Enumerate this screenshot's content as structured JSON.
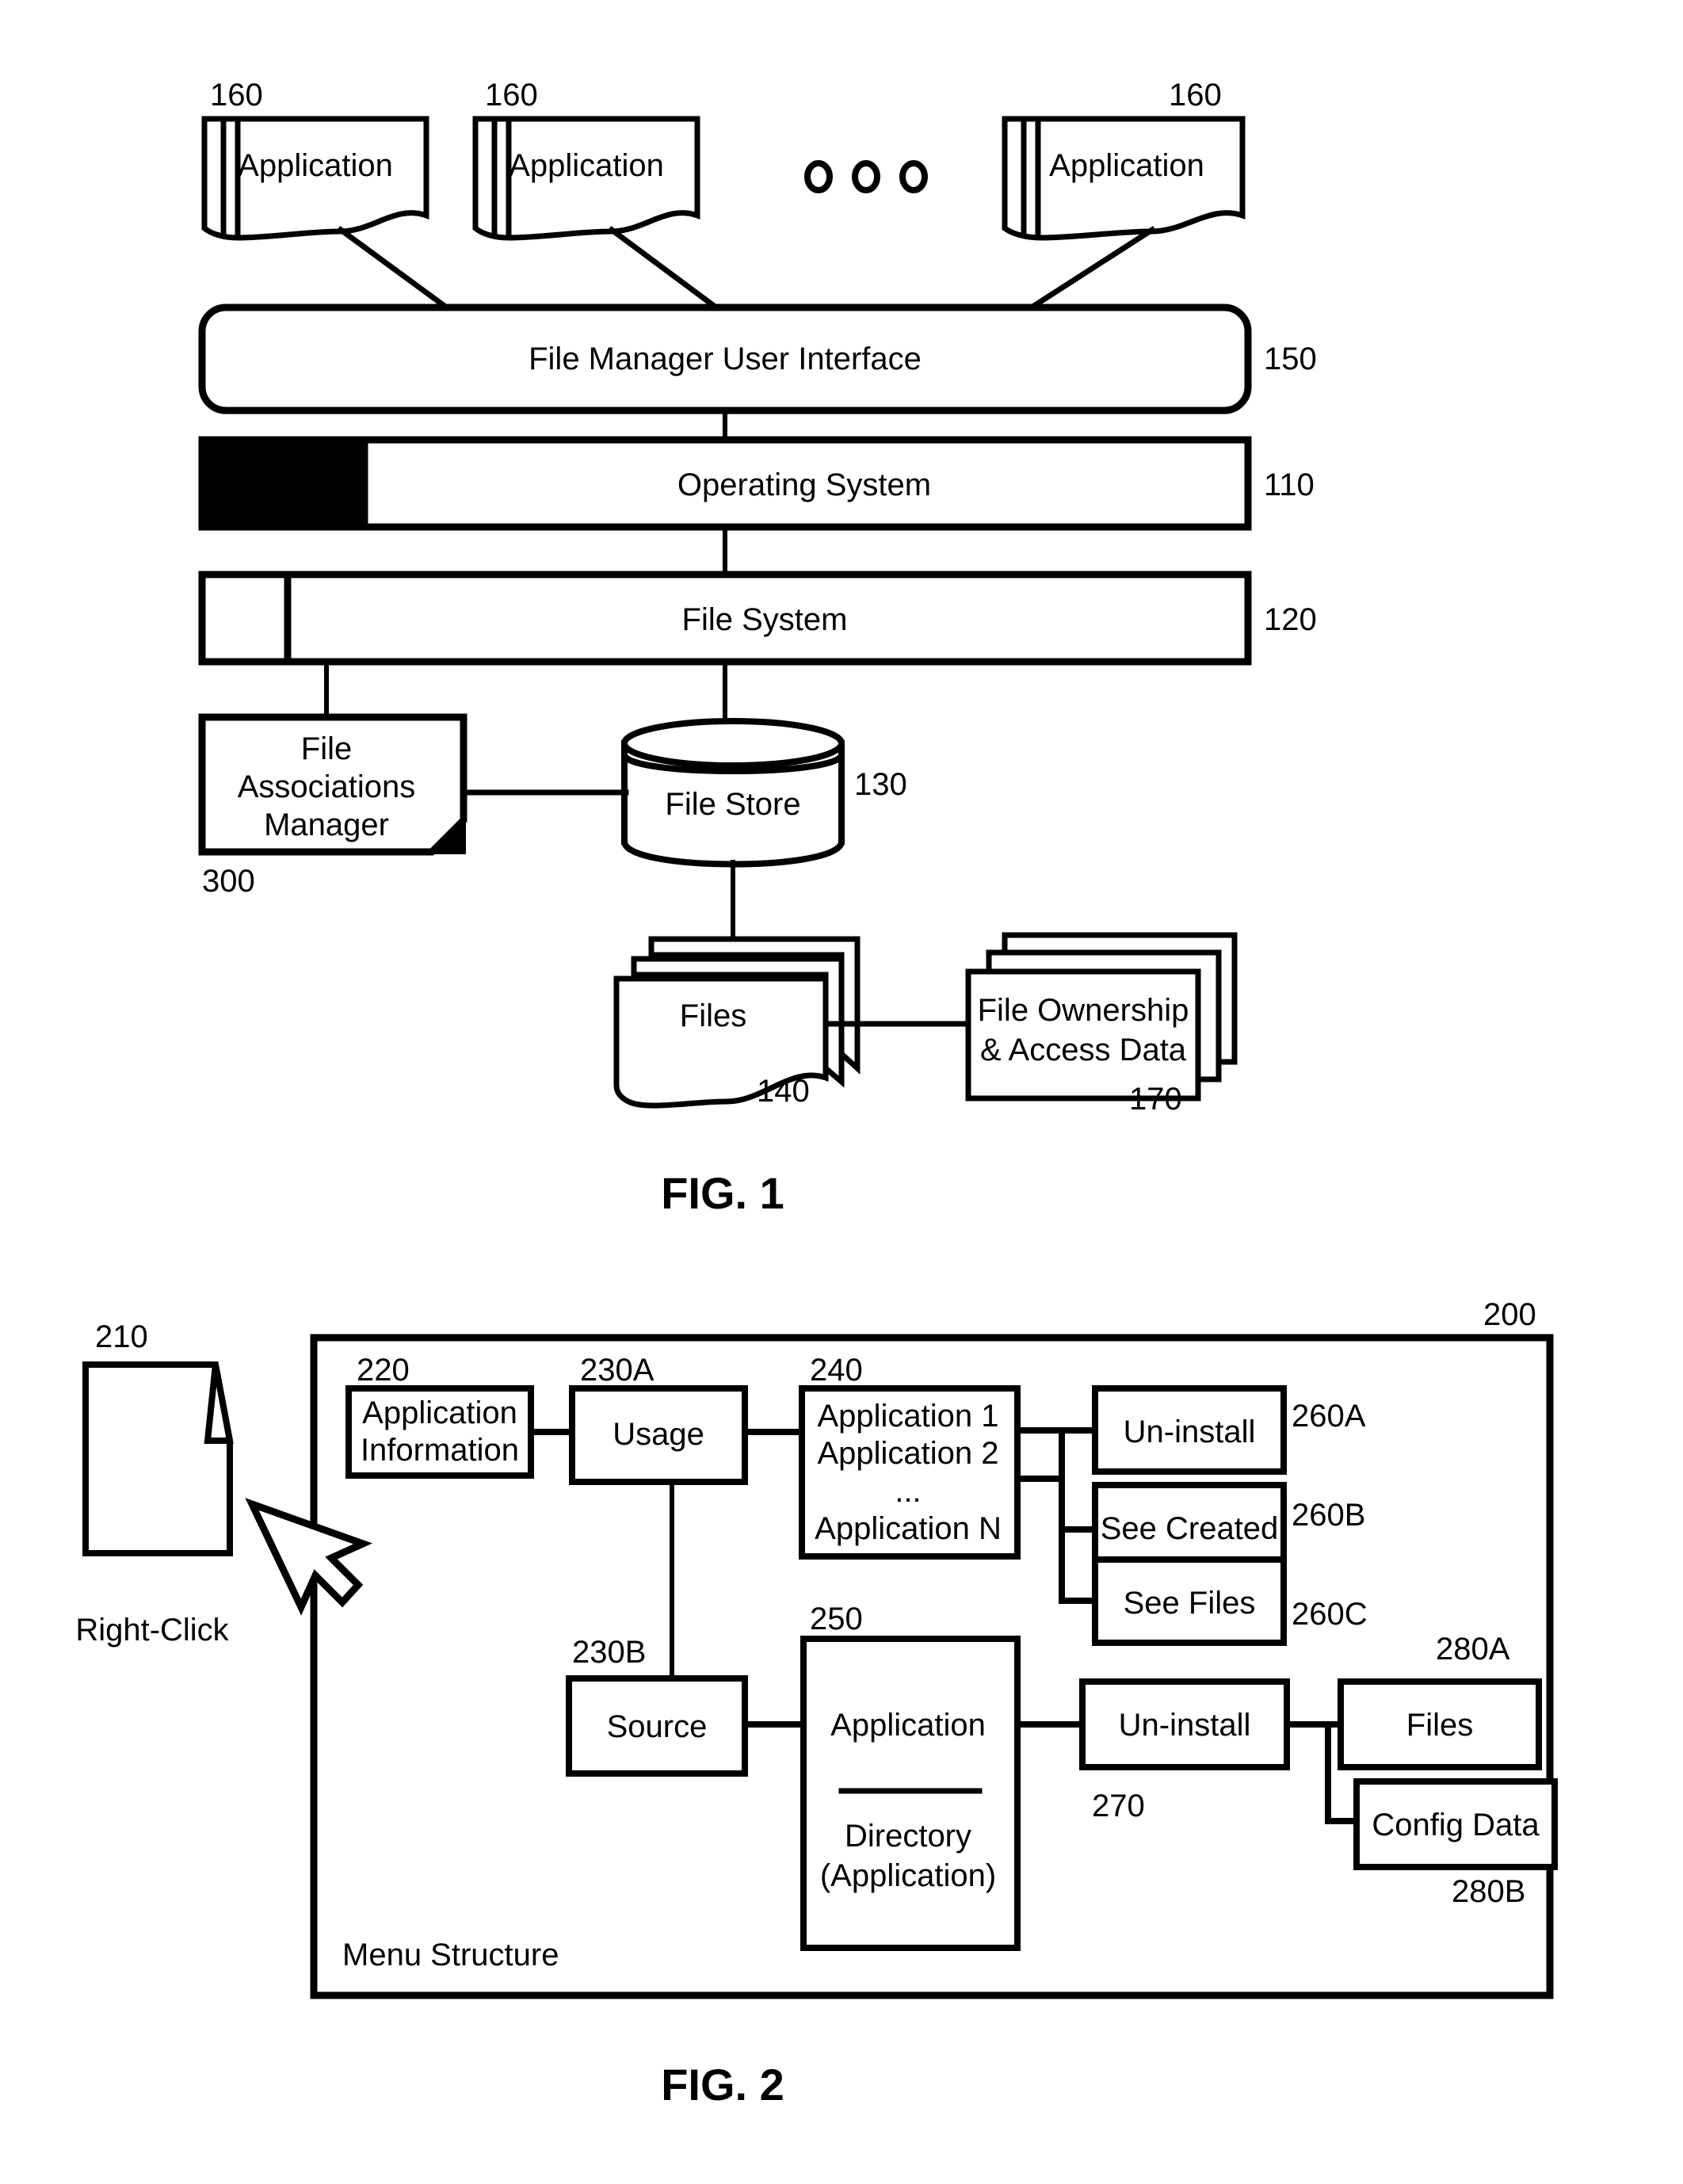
{
  "figure1": {
    "caption": "FIG. 1",
    "applications": [
      {
        "label": "Application",
        "ref": "160"
      },
      {
        "label": "Application",
        "ref": "160"
      },
      {
        "label": "Application",
        "ref": "160"
      }
    ],
    "ellipsis_dots": 3,
    "file_manager_ui": {
      "label": "File Manager User Interface",
      "ref": "150"
    },
    "operating_system": {
      "label": "Operating System",
      "ref": "110"
    },
    "file_system": {
      "label": "File System",
      "ref": "120"
    },
    "file_associations_manager": {
      "label_line1": "File",
      "label_line2": "Associations",
      "label_line3": "Manager",
      "ref": "300"
    },
    "file_store": {
      "label": "File Store",
      "ref": "130"
    },
    "files": {
      "label": "Files",
      "ref": "140"
    },
    "file_ownership": {
      "label_line1": "File Ownership",
      "label_line2": "& Access Data",
      "ref": "170"
    }
  },
  "figure2": {
    "caption": "FIG. 2",
    "container": {
      "ref": "200",
      "label": "Menu Structure"
    },
    "document_icon": {
      "ref": "210",
      "caption": "Right-Click"
    },
    "application_information": {
      "label_line1": "Application",
      "label_line2": "Information",
      "ref": "220"
    },
    "usage": {
      "label": "Usage",
      "ref": "230A"
    },
    "source": {
      "label": "Source",
      "ref": "230B"
    },
    "application_list": {
      "ref": "240",
      "lines": [
        "Application 1",
        "Application 2",
        "...",
        "Application N"
      ]
    },
    "usage_actions": [
      {
        "label": "Un-install",
        "ref": "260A"
      },
      {
        "label": "See Created",
        "ref": "260B"
      },
      {
        "label": "See Files",
        "ref": "260C"
      }
    ],
    "application_directory": {
      "ref": "250",
      "line1": "Application",
      "line2": "Directory",
      "line3": "(Application)"
    },
    "source_action": {
      "label": "Un-install",
      "ref": "270"
    },
    "source_results": [
      {
        "label": "Files",
        "ref": "280A"
      },
      {
        "label": "Config Data",
        "ref": "280B"
      }
    ]
  }
}
